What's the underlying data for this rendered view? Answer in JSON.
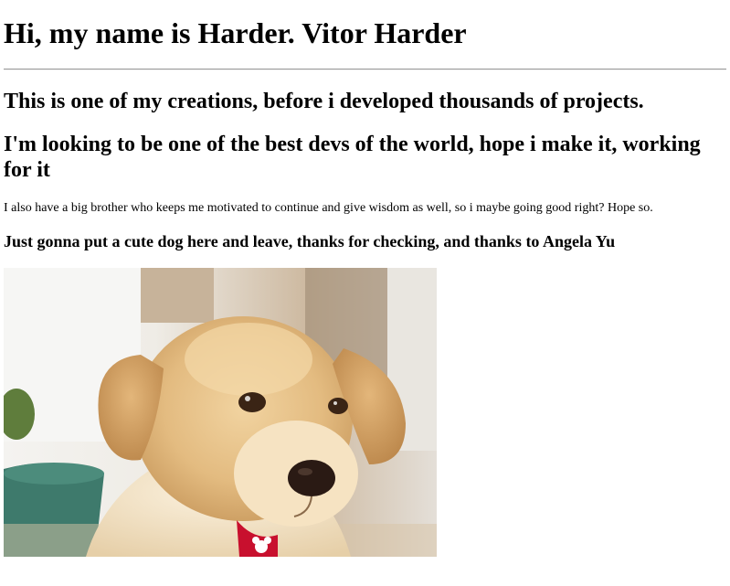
{
  "page": {
    "heading": "Hi, my name is Harder. Vitor Harder",
    "subheading_1": "This is one of my creations, before i developed thousands of projects.",
    "subheading_2": "I'm looking to be one of the best devs of the world, hope i make it, working for it",
    "paragraph": "I also have a big brother who keeps me motivated to continue and give wisdom as well, so i maybe going good right? Hope so.",
    "closing": "Just gonna put a cute dog here and leave, thanks for checking, and thanks to Angela Yu"
  },
  "image": {
    "subject": "puppy",
    "fur_color": "#e7c28c",
    "collar_color": "#c8102e"
  }
}
